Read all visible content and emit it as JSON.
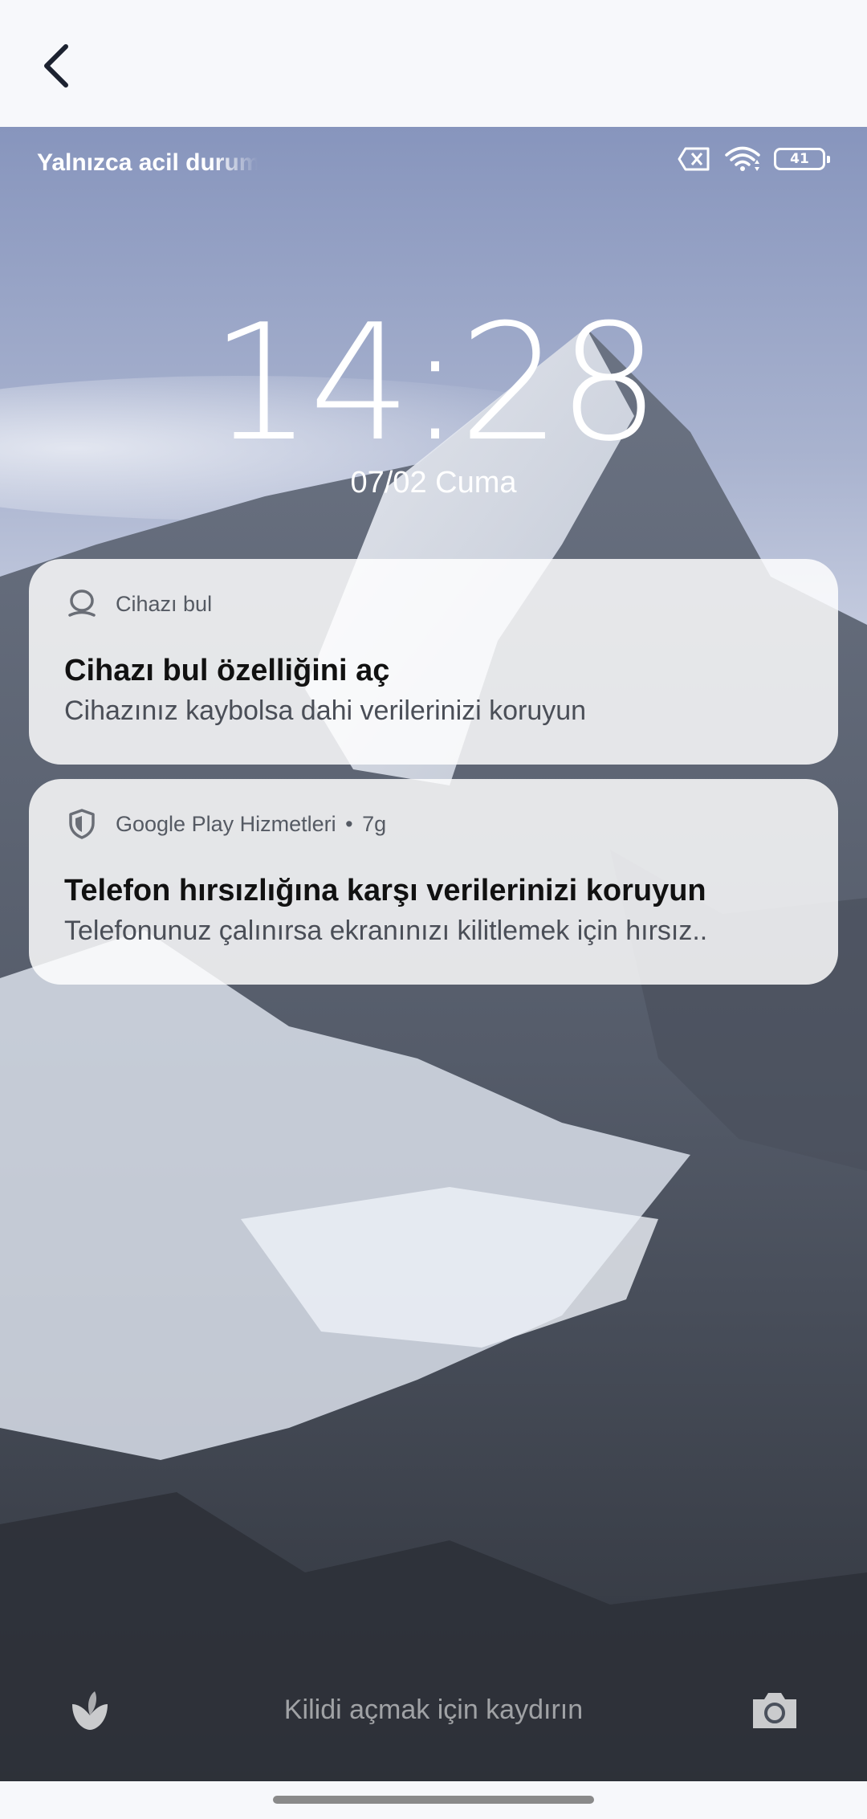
{
  "nav": {
    "back_icon": "chevron-left-icon"
  },
  "status_bar": {
    "carrier_text": "Yalnızca acil durum",
    "icons": [
      "no-sim-icon",
      "wifi-icon",
      "battery-icon"
    ],
    "battery_level": "41"
  },
  "lockscreen": {
    "time": "14:28",
    "date": "07/02 Cuma",
    "unlock_hint": "Kilidi açmak için kaydırın",
    "left_shortcut_icon": "leaf-icon",
    "right_shortcut_icon": "camera-icon"
  },
  "notifications": [
    {
      "app_icon": "find-device-icon",
      "app_name": "Cihazı bul",
      "time": "",
      "title": "Cihazı bul özelliğini aç",
      "body": "Cihazınız kaybolsa dahi verilerinizi koruyun"
    },
    {
      "app_icon": "shield-icon",
      "app_name": "Google Play Hizmetleri",
      "time": "7g",
      "title": "Telefon hırsızlığına karşı verilerinizi koruyun",
      "body": "Telefonunuz çalınırsa ekranınızı kilitlemek için hırsız.."
    }
  ],
  "colors": {
    "notification_bg": "#ffffff",
    "title_text": "#111111",
    "overlay_text": "#ffffff"
  }
}
